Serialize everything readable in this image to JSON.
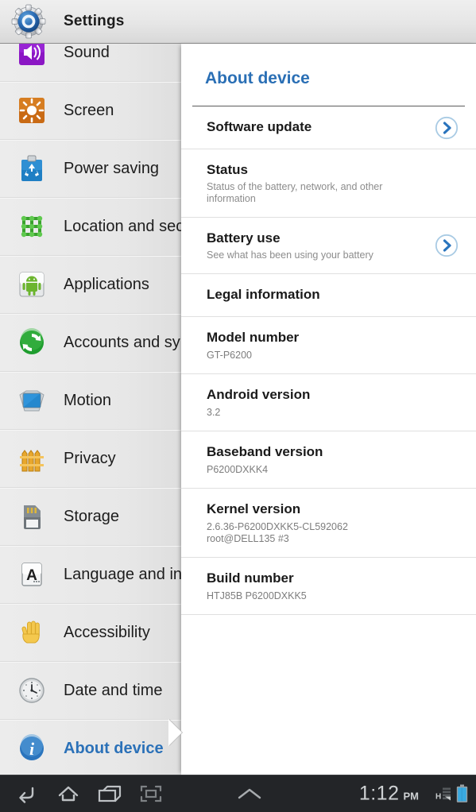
{
  "titlebar": {
    "icon": "settings-gear-icon",
    "title": "Settings"
  },
  "sidebar": {
    "items": [
      {
        "label": "Sound",
        "icon": "sound-speaker-icon",
        "selected": false
      },
      {
        "label": "Screen",
        "icon": "screen-brightness-icon",
        "selected": false
      },
      {
        "label": "Power saving",
        "icon": "power-saving-icon",
        "selected": false
      },
      {
        "label": "Location and security",
        "icon": "location-icon",
        "selected": false
      },
      {
        "label": "Applications",
        "icon": "android-applications-icon",
        "selected": false
      },
      {
        "label": "Accounts and sync",
        "icon": "sync-accounts-icon",
        "selected": false
      },
      {
        "label": "Motion",
        "icon": "motion-icon",
        "selected": false
      },
      {
        "label": "Privacy",
        "icon": "privacy-fence-icon",
        "selected": false
      },
      {
        "label": "Storage",
        "icon": "storage-sdcard-icon",
        "selected": false
      },
      {
        "label": "Language and input",
        "icon": "language-icon",
        "selected": false
      },
      {
        "label": "Accessibility",
        "icon": "accessibility-hand-icon",
        "selected": false
      },
      {
        "label": "Date and time",
        "icon": "clock-icon",
        "selected": false
      },
      {
        "label": "About device",
        "icon": "info-icon",
        "selected": true
      }
    ]
  },
  "panel": {
    "title": "About device",
    "items": [
      {
        "title": "Software update",
        "sub": "",
        "value": "",
        "chevron": true
      },
      {
        "title": "Status",
        "sub": "Status of the battery, network, and other information",
        "value": "",
        "chevron": false
      },
      {
        "title": "Battery use",
        "sub": "See what has been using your battery",
        "value": "",
        "chevron": true
      },
      {
        "title": "Legal information",
        "sub": "",
        "value": "",
        "chevron": false
      },
      {
        "title": "Model number",
        "sub": "",
        "value": "GT-P6200",
        "chevron": false
      },
      {
        "title": "Android version",
        "sub": "",
        "value": "3.2",
        "chevron": false
      },
      {
        "title": "Baseband version",
        "sub": "",
        "value": "P6200DXKK4",
        "chevron": false
      },
      {
        "title": "Kernel version",
        "sub": "",
        "value": "2.6.36-P6200DXKK5-CL592062\nroot@DELL135 #3",
        "chevron": false
      },
      {
        "title": "Build number",
        "sub": "",
        "value": "HTJ85B P6200DXKK5",
        "chevron": false
      }
    ]
  },
  "systembar": {
    "nav": [
      {
        "name": "back-icon",
        "label": "Back"
      },
      {
        "name": "home-icon",
        "label": "Home"
      },
      {
        "name": "recents-icon",
        "label": "Recent apps"
      },
      {
        "name": "screenshot-icon",
        "label": "Screenshot"
      }
    ],
    "expand": {
      "name": "chevron-up-icon",
      "label": "Show notifications"
    },
    "clock": {
      "time": "1:12",
      "ampm": "PM"
    },
    "status": [
      {
        "name": "signal-h-icon",
        "label": "H"
      },
      {
        "name": "battery-icon",
        "label": "Battery full"
      }
    ]
  },
  "colors": {
    "accent_blue": "#2a6fb5",
    "panel_bg": "#ffffff",
    "sidebar_bg": "#e9e9e9",
    "sysbar_bg": "#232528",
    "battery_blue": "#39a9e0"
  }
}
